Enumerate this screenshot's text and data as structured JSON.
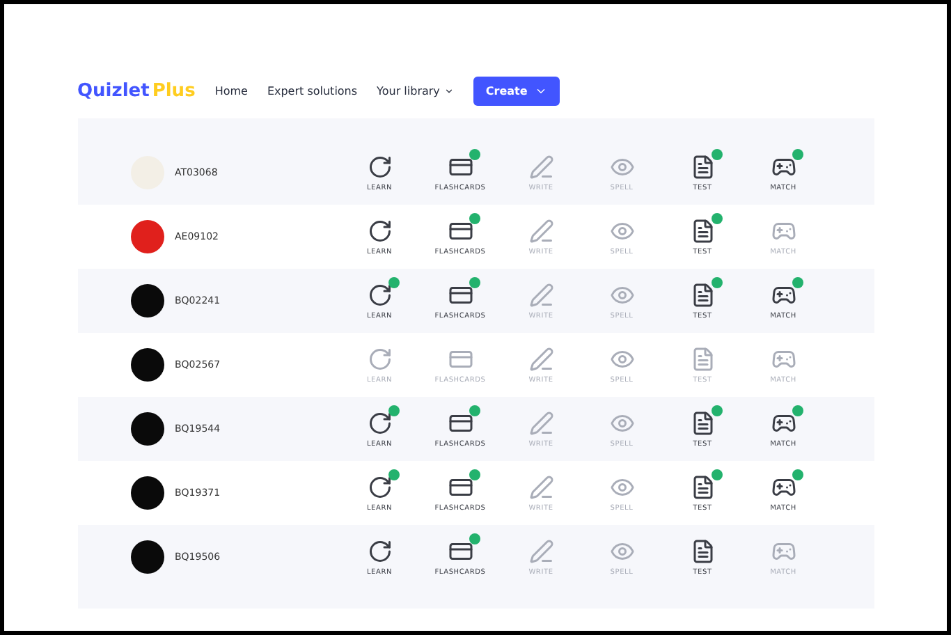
{
  "header": {
    "logo": "Quizlet",
    "logo_plus": "Plus",
    "nav": [
      {
        "label": "Home",
        "kind": "link"
      },
      {
        "label": "Expert solutions",
        "kind": "link"
      },
      {
        "label": "Your library",
        "kind": "dropdown"
      }
    ],
    "create_button": "Create"
  },
  "rows": [
    {
      "name": "AT03068",
      "color": "#f3efe6",
      "modes": [
        {
          "label": "LEARN",
          "enabled": true,
          "done": false
        },
        {
          "label": "FLASHCARDS",
          "enabled": true,
          "done": true
        },
        {
          "label": "WRITE",
          "enabled": false,
          "done": false
        },
        {
          "label": "SPELL",
          "enabled": false,
          "done": false
        },
        {
          "label": "TEST",
          "enabled": true,
          "done": true
        },
        {
          "label": "MATCH",
          "enabled": true,
          "done": true
        }
      ]
    },
    {
      "name": "AE09102",
      "color": "#e0201c",
      "modes": [
        {
          "label": "LEARN",
          "enabled": true,
          "done": false
        },
        {
          "label": "FLASHCARDS",
          "enabled": true,
          "done": true
        },
        {
          "label": "WRITE",
          "enabled": false,
          "done": false
        },
        {
          "label": "SPELL",
          "enabled": false,
          "done": false
        },
        {
          "label": "TEST",
          "enabled": true,
          "done": true
        },
        {
          "label": "MATCH",
          "enabled": false,
          "done": false
        }
      ]
    },
    {
      "name": "BQ02241",
      "color": "#0a0a0a",
      "modes": [
        {
          "label": "LEARN",
          "enabled": true,
          "done": true
        },
        {
          "label": "FLASHCARDS",
          "enabled": true,
          "done": true
        },
        {
          "label": "WRITE",
          "enabled": false,
          "done": false
        },
        {
          "label": "SPELL",
          "enabled": false,
          "done": false
        },
        {
          "label": "TEST",
          "enabled": true,
          "done": true
        },
        {
          "label": "MATCH",
          "enabled": true,
          "done": true
        }
      ]
    },
    {
      "name": "BQ02567",
      "color": "#0a0a0a",
      "modes": [
        {
          "label": "LEARN",
          "enabled": false,
          "done": false
        },
        {
          "label": "FLASHCARDS",
          "enabled": false,
          "done": false
        },
        {
          "label": "WRITE",
          "enabled": false,
          "done": false
        },
        {
          "label": "SPELL",
          "enabled": false,
          "done": false
        },
        {
          "label": "TEST",
          "enabled": false,
          "done": false
        },
        {
          "label": "MATCH",
          "enabled": false,
          "done": false
        }
      ]
    },
    {
      "name": "BQ19544",
      "color": "#0a0a0a",
      "modes": [
        {
          "label": "LEARN",
          "enabled": true,
          "done": true
        },
        {
          "label": "FLASHCARDS",
          "enabled": true,
          "done": true
        },
        {
          "label": "WRITE",
          "enabled": false,
          "done": false
        },
        {
          "label": "SPELL",
          "enabled": false,
          "done": false
        },
        {
          "label": "TEST",
          "enabled": true,
          "done": true
        },
        {
          "label": "MATCH",
          "enabled": true,
          "done": true
        }
      ]
    },
    {
      "name": "BQ19371",
      "color": "#0a0a0a",
      "modes": [
        {
          "label": "LEARN",
          "enabled": true,
          "done": true
        },
        {
          "label": "FLASHCARDS",
          "enabled": true,
          "done": true
        },
        {
          "label": "WRITE",
          "enabled": false,
          "done": false
        },
        {
          "label": "SPELL",
          "enabled": false,
          "done": false
        },
        {
          "label": "TEST",
          "enabled": true,
          "done": true
        },
        {
          "label": "MATCH",
          "enabled": true,
          "done": true
        }
      ]
    },
    {
      "name": "BQ19506",
      "color": "#0a0a0a",
      "modes": [
        {
          "label": "LEARN",
          "enabled": true,
          "done": false
        },
        {
          "label": "FLASHCARDS",
          "enabled": true,
          "done": true
        },
        {
          "label": "WRITE",
          "enabled": false,
          "done": false
        },
        {
          "label": "SPELL",
          "enabled": false,
          "done": false
        },
        {
          "label": "TEST",
          "enabled": true,
          "done": false
        },
        {
          "label": "MATCH",
          "enabled": false,
          "done": false
        }
      ]
    }
  ]
}
